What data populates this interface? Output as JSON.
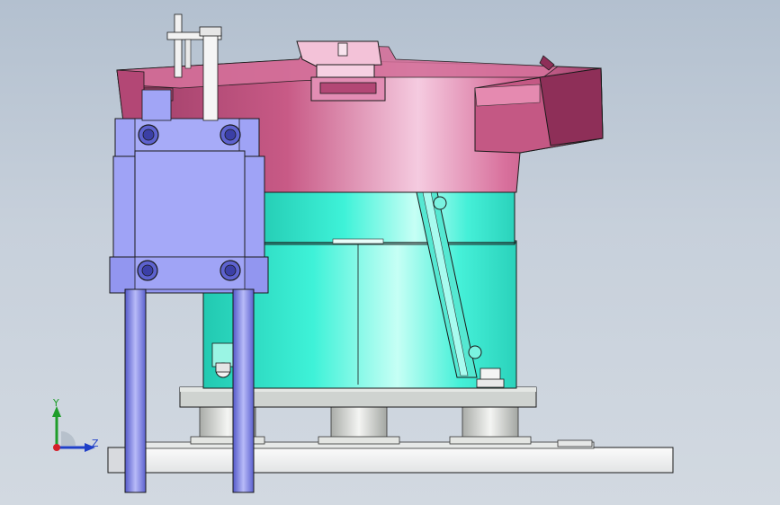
{
  "viewport": {
    "background_top": "#b3c0cf",
    "background_bottom": "#d2d9e1"
  },
  "model": {
    "colors": {
      "bowl": "#c85a86",
      "bowl_highlight": "#f2c0d6",
      "bowl_dark": "#8e2f58",
      "body": "#3ef2d8",
      "body_highlight": "#b7fff3",
      "bracket": "#9fa3f6",
      "bracket_dark": "#6d72d8",
      "base_plate": "#f0f1f2",
      "mount_plate": "#cfd3d0",
      "column": "#7a7ee8",
      "feet": "#d6d9d6",
      "outline": "#1a1a1a"
    }
  },
  "triad": {
    "y_label": "Y",
    "z_label": "Z",
    "y_color": "#1f9d2a",
    "z_color": "#1f3fc8",
    "origin_color": "#d4202a"
  }
}
